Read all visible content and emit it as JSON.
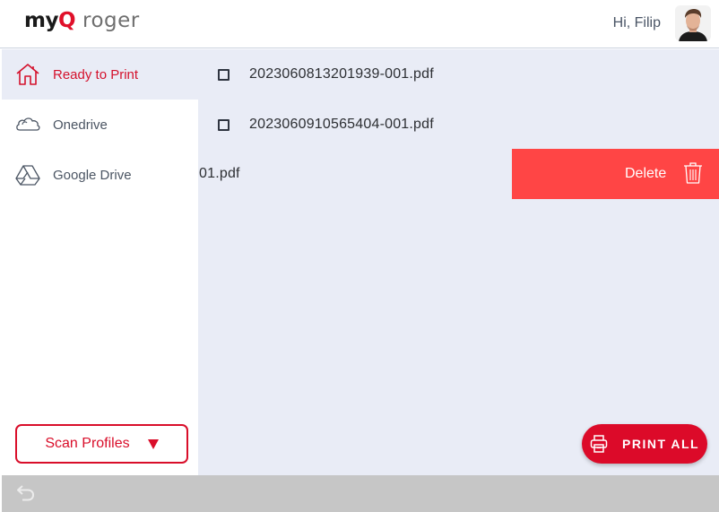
{
  "header": {
    "logo_brand": "myQ",
    "logo_product": "roger",
    "greeting": "Hi, Filip",
    "avatar_icon": "user-avatar"
  },
  "sidebar": {
    "items": [
      {
        "label": "Ready to Print",
        "icon": "home-icon",
        "active": true
      },
      {
        "label": "Onedrive",
        "icon": "cloud-icon",
        "active": false
      },
      {
        "label": "Google Drive",
        "icon": "google-drive-icon",
        "active": false
      }
    ],
    "scan_profiles_label": "Scan Profiles"
  },
  "files": [
    {
      "name": "2023060813201939-001.pdf"
    },
    {
      "name": "2023060910565404-001.pdf"
    },
    {
      "name": "01.pdf",
      "swiped": true
    }
  ],
  "delete_action": {
    "label": "Delete",
    "icon": "trash-icon"
  },
  "print_all": {
    "label": "PRINT ALL",
    "icon": "printer-icon"
  },
  "bottom_bar": {
    "back_icon": "back-icon"
  },
  "colors": {
    "accent": "#dc0a29",
    "delete": "#ff4545",
    "content_bg": "#e9ecf6",
    "bottom_bar": "#c6c6c6"
  }
}
